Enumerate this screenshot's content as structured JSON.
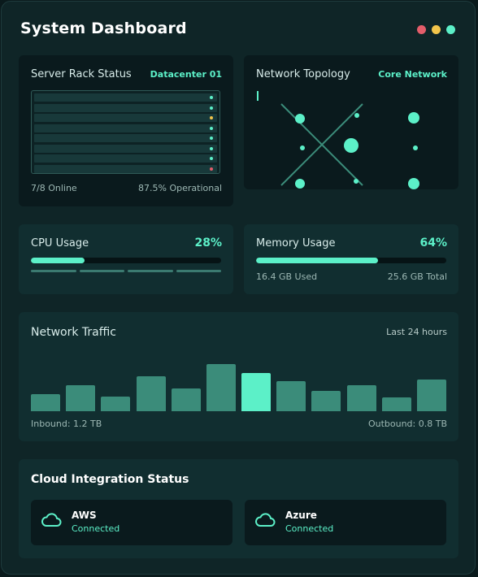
{
  "header": {
    "title": "System Dashboard",
    "window_dots": [
      "#e35d6a",
      "#f2c54b",
      "#5cf0c8"
    ]
  },
  "server_rack": {
    "title": "Server Rack Status",
    "location": "Datacenter 01",
    "units": [
      {
        "status": "online",
        "color": "#5cf0c8"
      },
      {
        "status": "online",
        "color": "#5cf0c8"
      },
      {
        "status": "warning",
        "color": "#f2c54b"
      },
      {
        "status": "online",
        "color": "#5cf0c8"
      },
      {
        "status": "online",
        "color": "#5cf0c8"
      },
      {
        "status": "online",
        "color": "#5cf0c8"
      },
      {
        "status": "online",
        "color": "#5cf0c8"
      },
      {
        "status": "offline",
        "color": "#e35d6a"
      }
    ],
    "online_text": "7/8 Online",
    "operational_text": "87.5% Operational"
  },
  "network_topology": {
    "title": "Network Topology",
    "scope": "Core Network"
  },
  "cpu": {
    "title": "CPU Usage",
    "percent_text": "28%",
    "percent": 28
  },
  "memory": {
    "title": "Memory Usage",
    "percent_text": "64%",
    "percent": 64,
    "used_text": "16.4 GB Used",
    "total_text": "25.6 GB Total"
  },
  "network_traffic": {
    "title": "Network Traffic",
    "period": "Last 24 hours",
    "inbound_text": "Inbound: 1.2 TB",
    "outbound_text": "Outbound: 0.8 TB",
    "bars": [
      0.36,
      0.55,
      0.31,
      0.74,
      0.48,
      1.0,
      0.81,
      0.63,
      0.43,
      0.55,
      0.3,
      0.68
    ],
    "highlight_index": 6
  },
  "cloud": {
    "title": "Cloud Integration Status",
    "providers": [
      {
        "name": "AWS",
        "status": "Connected"
      },
      {
        "name": "Azure",
        "status": "Connected"
      }
    ]
  }
}
